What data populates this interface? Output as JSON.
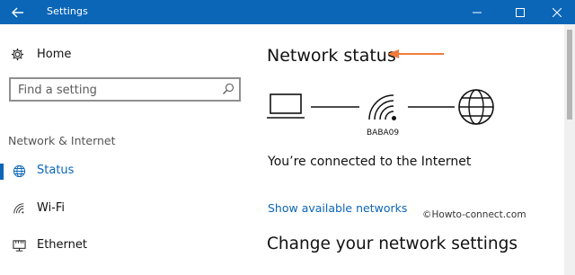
{
  "window": {
    "title": "Settings",
    "accent_color": "#0b66b8"
  },
  "sidebar": {
    "home_label": "Home",
    "search_placeholder": "Find a setting",
    "section_title": "Network & Internet",
    "items": [
      {
        "label": "Status",
        "icon": "globe-icon",
        "active": true
      },
      {
        "label": "Wi-Fi",
        "icon": "wifi-icon",
        "active": false
      },
      {
        "label": "Ethernet",
        "icon": "ethernet-icon",
        "active": false
      }
    ]
  },
  "main": {
    "title": "Network status",
    "network_name": "BABA09",
    "connection_text": "You’re connected to the Internet",
    "show_networks_link": "Show available networks",
    "watermark": "©Howto-connect.com",
    "change_heading": "Change your network settings",
    "annotation_arrow_color": "#f07a3c"
  }
}
